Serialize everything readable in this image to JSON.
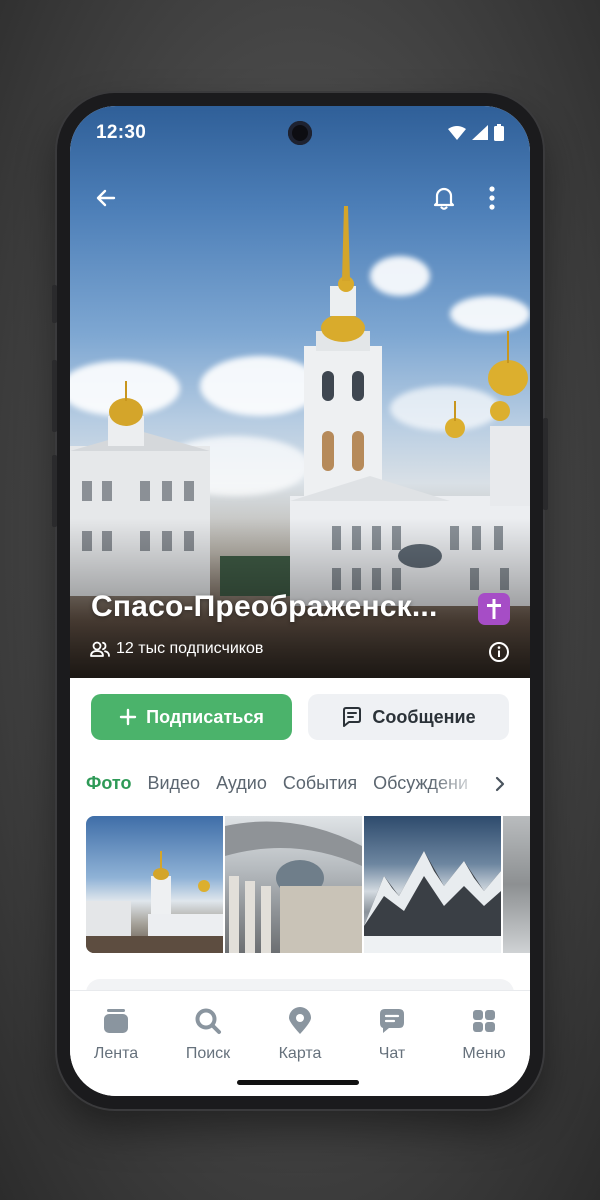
{
  "status_bar": {
    "time": "12:30"
  },
  "community": {
    "name": "Спасо-Преображенск...",
    "subscribers": "12 тыс подписчиков"
  },
  "actions": {
    "subscribe_label": "Подписаться",
    "message_label": "Сообщение"
  },
  "tabs": [
    {
      "label": "Фото",
      "active": true
    },
    {
      "label": "Видео"
    },
    {
      "label": "Аудио"
    },
    {
      "label": "События"
    },
    {
      "label": "Обсуждени"
    }
  ],
  "bottom_nav": [
    {
      "label": "Лента",
      "icon": "feed-icon"
    },
    {
      "label": "Поиск",
      "icon": "search-icon"
    },
    {
      "label": "Карта",
      "icon": "map-pin-icon"
    },
    {
      "label": "Чат",
      "icon": "chat-icon"
    },
    {
      "label": "Меню",
      "icon": "grid-menu-icon"
    }
  ],
  "colors": {
    "accent_green": "#4bb36b",
    "active_tab": "#2e9a57",
    "badge_purple": "#a64dc6"
  }
}
